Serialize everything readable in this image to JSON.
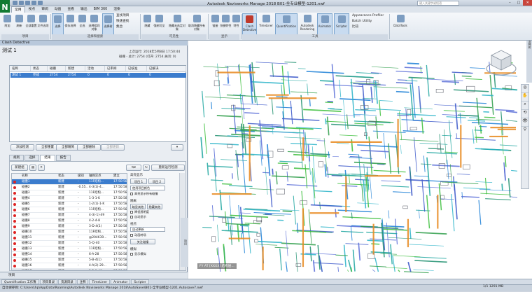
{
  "app": {
    "title": "Autodesk Navisworks Manage 2018   B01-全专业模型-1201.nwf",
    "search_placeholder": "键入关键字或短语",
    "logo": "N"
  },
  "tabs": [
    "常用",
    "视点",
    "审阅",
    "动画",
    "查看",
    "输出",
    "BIM 360",
    "渲染"
  ],
  "ribbon": {
    "buttons": [
      "附加",
      "刷新",
      "全部重置",
      "文件选项",
      "选择",
      "保存选择",
      "全选",
      "选择相同对象",
      "选择树",
      "查找项目",
      "快速查找",
      "集合",
      "隐藏",
      "强制可见",
      "隐藏未选定对象",
      "取消隐藏所有对象",
      "链接",
      "快捷特性",
      "特性",
      "Clash Detective",
      "TimeLiner",
      "Quantification",
      "Autodesk Rendering",
      "Animator",
      "Scripter",
      "DataTools"
    ],
    "small": [
      "查找项目",
      "快速查找",
      "集合",
      "Appearance Profiler",
      "Batch Utility",
      "比较"
    ],
    "groups": [
      "项目",
      "选择和搜索",
      "可见性",
      "显示",
      "工具"
    ]
  },
  "panel": {
    "title": "Clash Detective",
    "test_name": "测试 1",
    "last_run": "上次运行: 2018年5月8日 17:50:44",
    "summary": "碰撞 - 总计: 2754 (打开: 2754 关闭: 0)",
    "columns": [
      "名称",
      "状态",
      "碰撞",
      "新建",
      "活动",
      "已审阅",
      "已核准",
      "已解决"
    ],
    "test_row": [
      "测试 1",
      "完成",
      "2754",
      "2754",
      "0",
      "0",
      "0",
      "0"
    ],
    "status_colors": [
      "#d22",
      "#e8a33a",
      "#2a8fe0",
      "#3cb44b",
      "#e2c42b"
    ],
    "buttons": [
      "添加检测",
      "全部重置",
      "全部精简",
      "全部删除",
      "全部更新"
    ],
    "subtabs": [
      "规则",
      "选择",
      "结果",
      "报告"
    ],
    "results_buttons": [
      "新建组",
      "重新运行检测"
    ],
    "results_columns": [
      "名称",
      "状态",
      "级别",
      "轴网交点",
      "建立"
    ],
    "results": [
      [
        "碰撞1",
        "新建",
        "-",
        "11F结构...",
        "17:50:58 08-05"
      ],
      [
        "碰撞2",
        "新建",
        "-0.55...",
        "4-3(1)-4...",
        "17:50:58 08-05"
      ],
      [
        "碰撞3",
        "新建",
        "-",
        "11F结构...",
        "17:50:58 08-05"
      ],
      [
        "碰撞4",
        "新建",
        "-",
        "1-3-1-K",
        "17:50:58 08-05"
      ],
      [
        "碰撞5",
        "新建",
        "-",
        "1-2(1)-1-K",
        "17:50:58 08-05"
      ],
      [
        "碰撞6",
        "新建",
        "-",
        "11F结构...",
        "17:50:58 08-05"
      ],
      [
        "碰撞7",
        "新建",
        "-",
        "4-3(-1)-49",
        "17:50:58 08-05"
      ],
      [
        "碰撞8",
        "新建",
        "-",
        "4-2-4-8",
        "17:50:58 08-05"
      ],
      [
        "碰撞9",
        "新建",
        "-",
        "3-D-4(1)",
        "17:50:58 08-05"
      ],
      [
        "碰撞10",
        "新建",
        "-",
        "11F结构...",
        "17:50:58 08-05"
      ],
      [
        "碰撞11",
        "新建",
        "-",
        "@204639...",
        "17:50:58 08-05"
      ],
      [
        "碰撞12",
        "新建",
        "-",
        "5-Q-40",
        "17:50:58 08-05"
      ],
      [
        "碰撞13",
        "新建",
        "-",
        "11F结构...",
        "17:50:58 08-05"
      ],
      [
        "碰撞14",
        "新建",
        "-",
        "6-A-28",
        "17:50:58 08-05"
      ],
      [
        "碰撞15",
        "新建",
        "-",
        "5-B-4(1)",
        "17:50:58 08-05"
      ],
      [
        "碰撞16",
        "新建",
        "-",
        "4-A(2)-29...",
        "17:50:58 08-05"
      ],
      [
        "碰撞17",
        "新建",
        "-",
        "5-B-1-48",
        "17:50:58 08-05"
      ]
    ],
    "options": {
      "highlight_label": "高亮显示",
      "item1": "项目 1",
      "item2": "项目 2",
      "color_select": "使用项目颜色",
      "highlight_all": "高亮显示所有碰撞",
      "isolate_label": "隔离",
      "dim_others": "暗显其他",
      "hide_others": "隐藏其他",
      "reduce_transparency": "降低透明度",
      "auto_reveal": "自动显示",
      "viewpoint_label": "视点",
      "viewpoint_select": "自动更新",
      "animate": "动画转场",
      "focus_clash": "关注碰撞",
      "simulation_label": "模拟",
      "show_simulation": "显示模拟"
    },
    "side_strip": "项目",
    "dock_label": "项目"
  },
  "bottom_tabs": [
    "Quantification 工作簿",
    "项目目录",
    "资源目录",
    "注释",
    "TimeLiner",
    "Animator",
    "Scripter"
  ],
  "status": {
    "path": "自动保存到: C:\\Users\\hp\\AppData\\Roaming\\Autodesk Navisworks Manage 2018\\AutoSave\\B01-全专业模型-1201.Autosave7.nwf",
    "right": "1/1   1291 MB"
  },
  "viewport": {
    "label": "FY AT [XXXX] 结构层...",
    "background": "#ffffff"
  },
  "right_dock": "选择树"
}
